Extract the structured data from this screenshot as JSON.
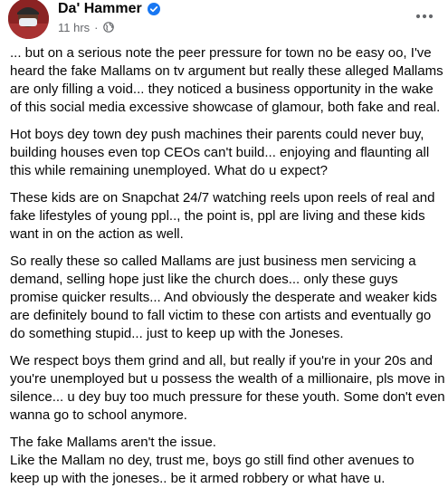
{
  "post": {
    "author_name": "Da' Hammer",
    "timestamp": "11 hrs",
    "separator": "·",
    "paragraphs": [
      "... but on a serious note the peer pressure for town no be easy oo, I've heard the fake Mallams on tv argument but really these alleged Mallams are only filling a void... they noticed a business opportunity in the wake of this social media excessive showcase of glamour, both fake and real.",
      "Hot boys dey town dey push machines their parents could never buy, building houses even top CEOs can't build... enjoying and flaunting all this while remaining unemployed. What do u expect?",
      "These kids are on Snapchat 24/7 watching reels upon reels of real and fake lifestyles of young ppl.., the point is, ppl are living and these kids want in on the action as well.",
      "So really these so called Mallams are just business men servicing a demand, selling hope just like the church does... only these guys promise quicker results... And obviously the desperate and weaker kids are definitely bound to fall victim to these con artists and eventually go do something stupid... just to keep up with the Joneses.",
      "We respect boys them grind and all, but really if you're in your 20s and you're unemployed but u possess the wealth of a millionaire, pls move in silence... u dey buy too much pressure for these youth. Some don't even wanna go to school anymore.",
      "The fake Mallams aren't the issue.",
      "Like the Mallam no dey, trust me, boys go still find other avenues to keep up with the joneses.. be it armed robbery or what have u."
    ]
  },
  "icons": {
    "verified": "verified-badge-icon",
    "privacy": "globe-icon",
    "more": "more-options-icon"
  },
  "colors": {
    "text": "#050505",
    "secondary_text": "#65676b",
    "verified_blue": "#1877f2"
  }
}
